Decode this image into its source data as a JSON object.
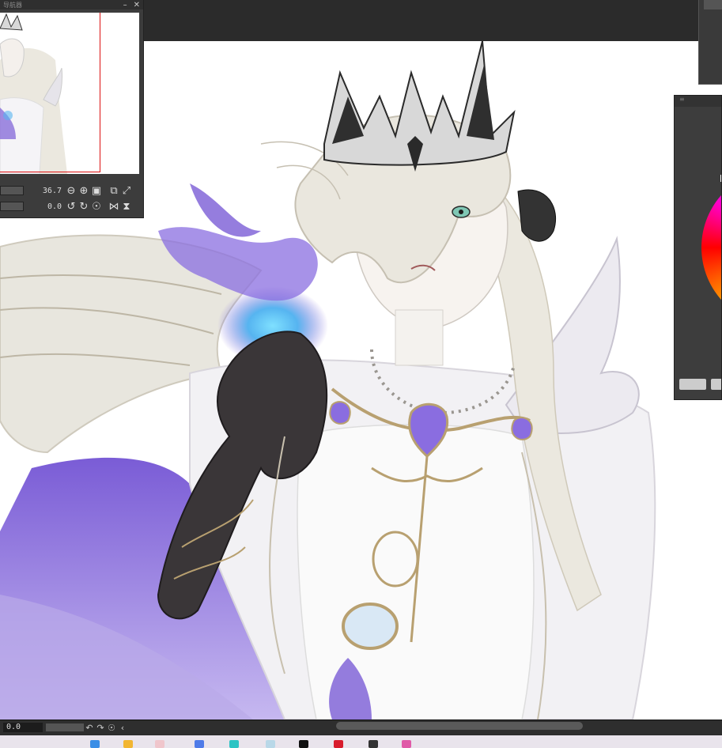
{
  "navigator": {
    "title": "导航器",
    "zoom_value": "36.7",
    "rotation_value": "0.0",
    "icons": [
      "zoom-out-icon",
      "zoom-in-icon",
      "fit-icon",
      "actual-size-icon",
      "fit-screen-icon",
      "rotate-left-icon",
      "rotate-right-icon",
      "reset-rotation-icon",
      "flip-horizontal-icon",
      "flip-vertical-icon"
    ]
  },
  "statusbar": {
    "zoom_value": "0.0",
    "icons": [
      "rotate-left-icon",
      "rotate-right-icon",
      "reset-rotation-icon",
      "prev-icon"
    ]
  },
  "colors": {
    "ui_dark": "#2b2b2b",
    "panel": "#3c3c3c",
    "accent_purple": "#7a5cd6",
    "glow_blue": "#56b4f0",
    "gold": "#b8a070"
  },
  "taskbar": {
    "icons": [
      "windows-start-icon",
      "file-explorer-icon",
      "app-icon",
      "app-icon",
      "app-icon",
      "app-icon",
      "app-icon",
      "app-icon",
      "app-icon",
      "app-icon"
    ]
  }
}
